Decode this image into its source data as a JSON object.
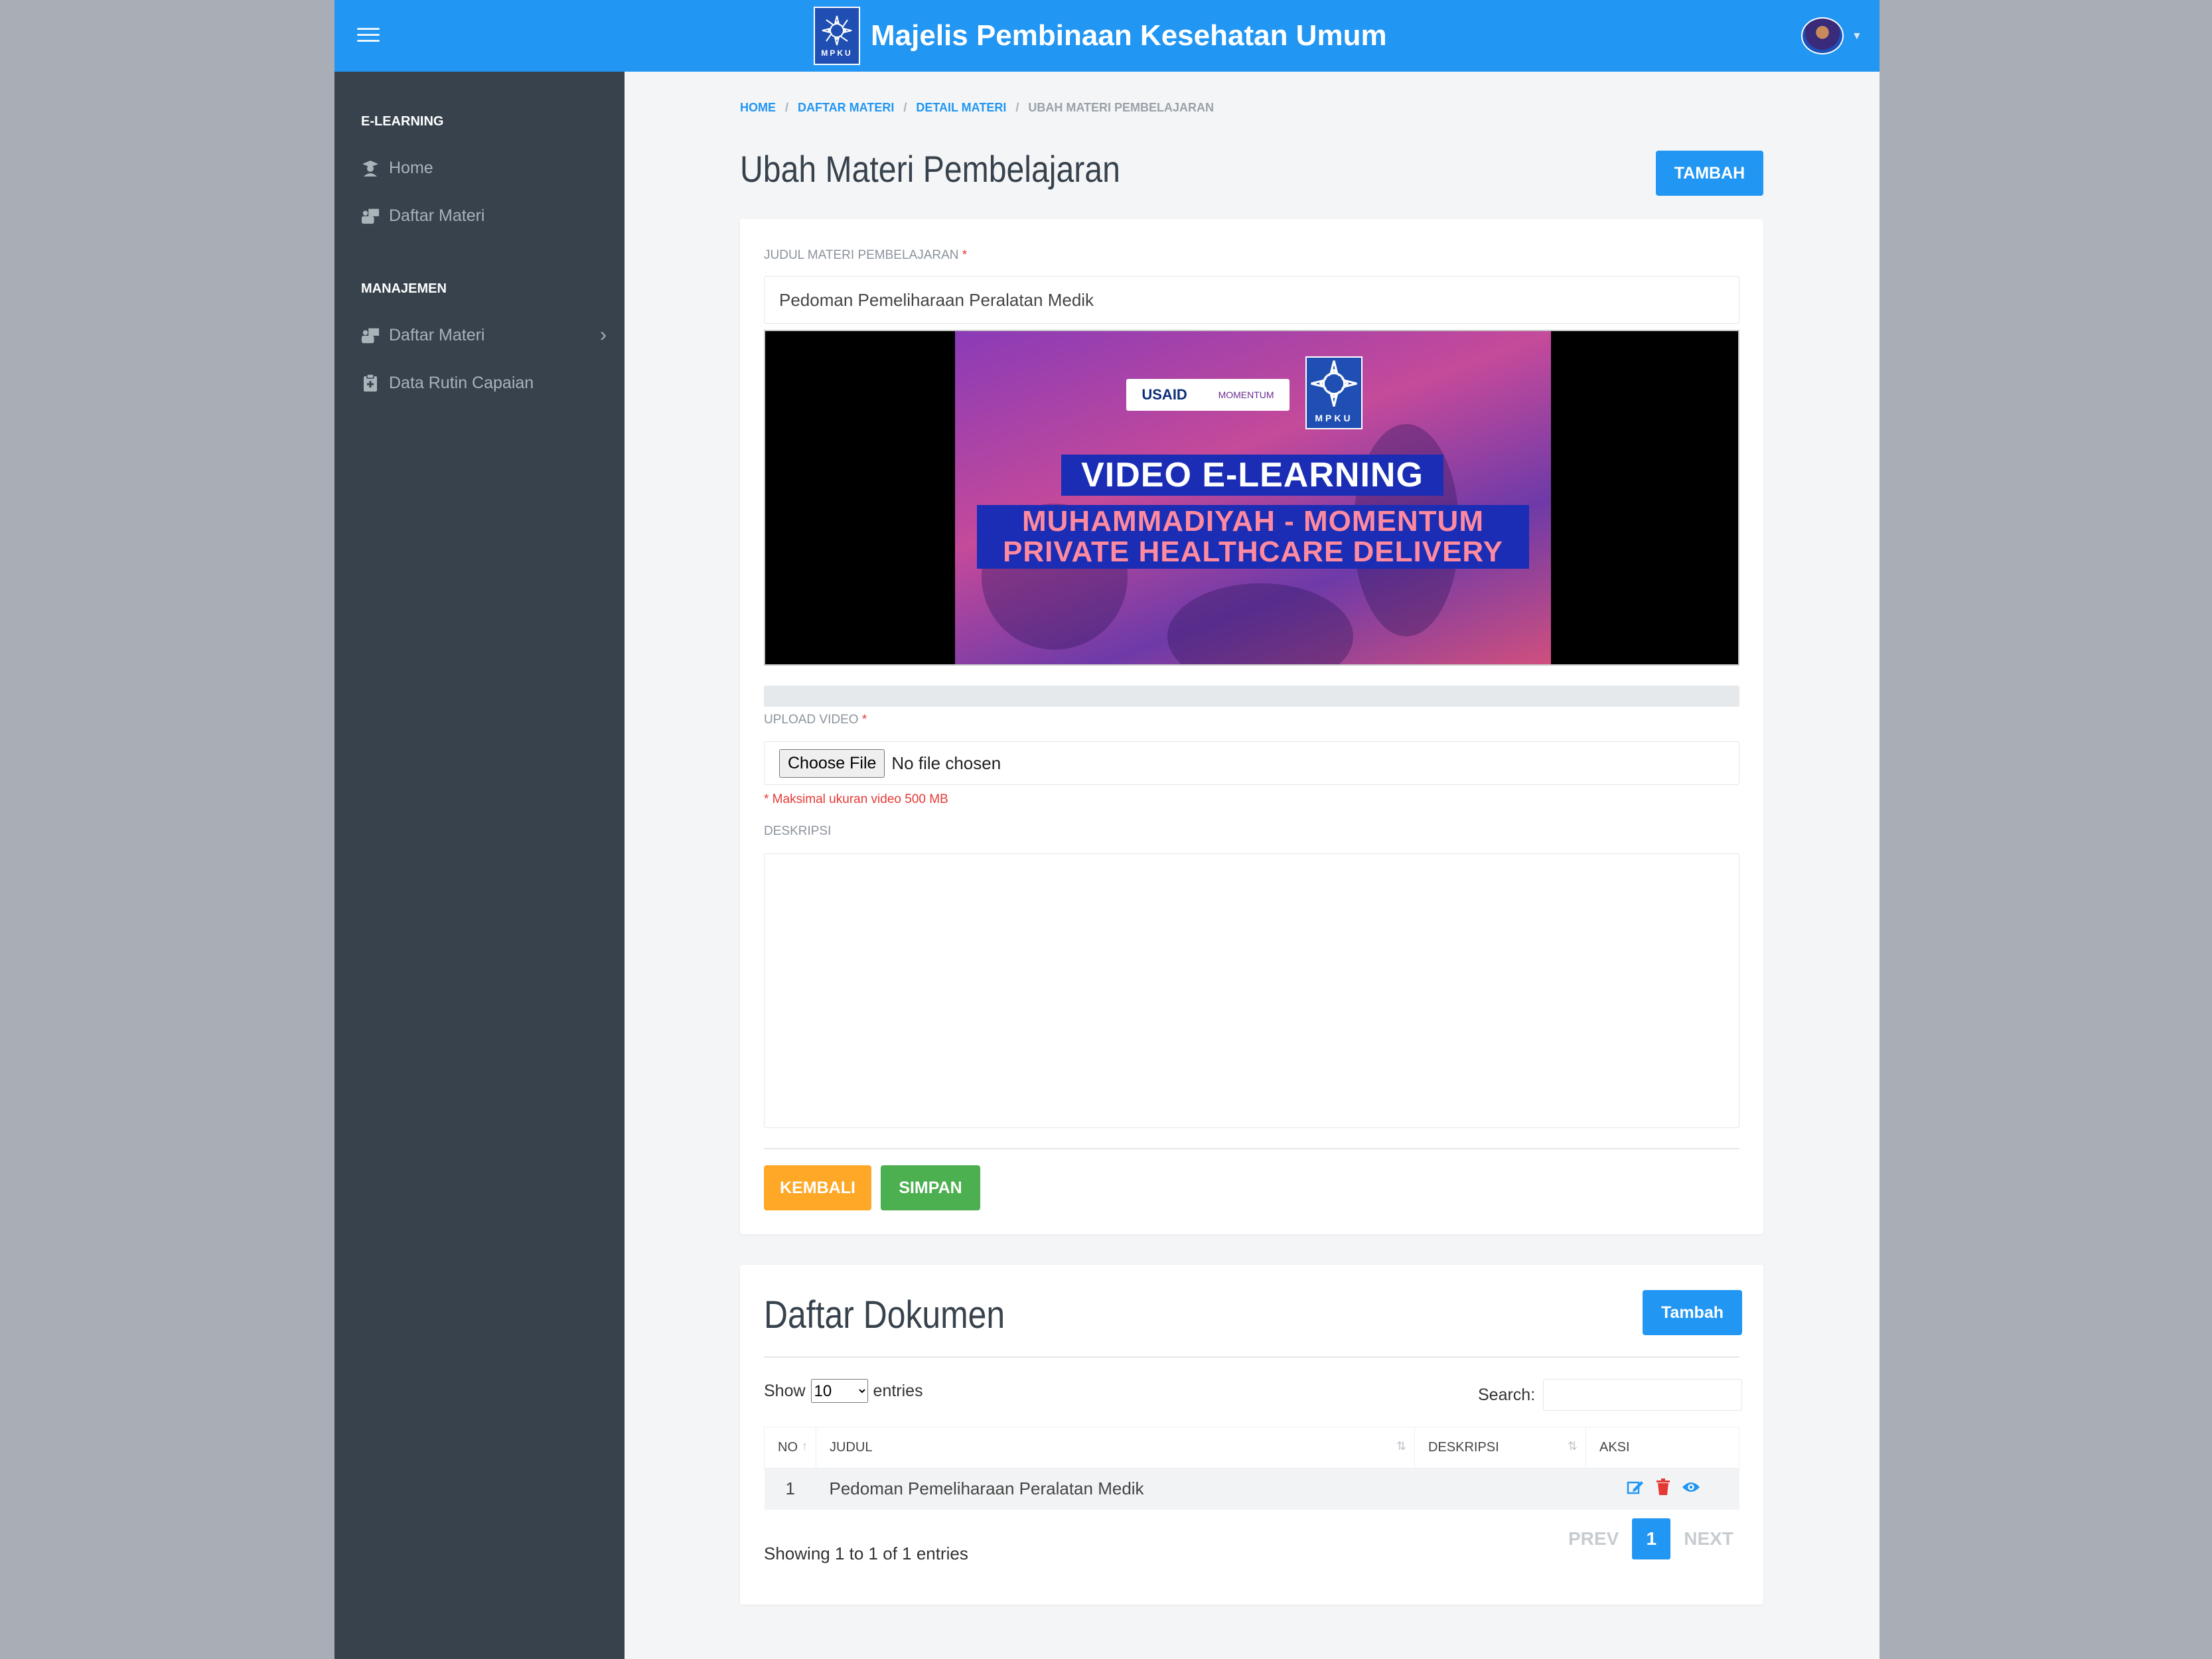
{
  "header": {
    "title": "Majelis Pembinaan Kesehatan Umum",
    "logo_text": "MPKU",
    "brand_color": "#2196f3"
  },
  "sidebar": {
    "sections": [
      {
        "heading": "E-LEARNING",
        "items": [
          {
            "label": "Home",
            "icon": "user-graduate-icon"
          },
          {
            "label": "Daftar Materi",
            "icon": "chalkboard-teacher-icon"
          }
        ]
      },
      {
        "heading": "MANAJEMEN",
        "items": [
          {
            "label": "Daftar Materi",
            "icon": "chalkboard-teacher-icon",
            "has_submenu": true
          },
          {
            "label": "Data Rutin Capaian",
            "icon": "clipboard-medical-icon"
          }
        ]
      }
    ]
  },
  "breadcrumb": [
    "HOME",
    "DAFTAR MATERI",
    "DETAIL MATERI",
    "UBAH MATERI PEMBELAJARAN"
  ],
  "page": {
    "title": "Ubah Materi Pembelajaran",
    "add_button": "TAMBAH"
  },
  "form": {
    "title_label": "JUDUL MATERI PEMBELAJARAN",
    "title_value": "Pedoman Pemeliharaan Peralatan Medik",
    "video": {
      "logos": {
        "usaid": "USAID",
        "momentum": "MOMENTUM",
        "mpku": "MPKU"
      },
      "line1": "VIDEO E-LEARNING",
      "line2": "MUHAMMADIYAH - MOMENTUM",
      "line3": "PRIVATE HEALTHCARE DELIVERY"
    },
    "upload_progress": 0,
    "upload_label": "UPLOAD VIDEO",
    "choose_file": "Choose File",
    "no_file": "No file chosen",
    "hint": "* Maksimal ukuran video 500 MB",
    "desc_label": "DESKRIPSI",
    "desc_value": "",
    "back_button": "KEMBALI",
    "save_button": "SIMPAN",
    "required_mark": "*"
  },
  "documents": {
    "title": "Daftar Dokumen",
    "add_button": "Tambah",
    "show_prefix": "Show",
    "show_value": "10",
    "show_suffix": "entries",
    "search_label": "Search:",
    "columns": [
      "NO",
      "JUDUL",
      "DESKRIPSI",
      "AKSI"
    ],
    "rows": [
      {
        "no": "1",
        "judul": "Pedoman Pemeliharaan Peralatan Medik",
        "deskripsi": ""
      }
    ],
    "info": "Showing 1 to 1 of 1 entries",
    "pager": {
      "prev": "PREV",
      "current": "1",
      "next": "NEXT"
    }
  },
  "colors": {
    "sidebar": "#37424c",
    "primary": "#2196f3",
    "warning": "#ffa726",
    "success": "#4caf50",
    "danger": "#e53935"
  }
}
